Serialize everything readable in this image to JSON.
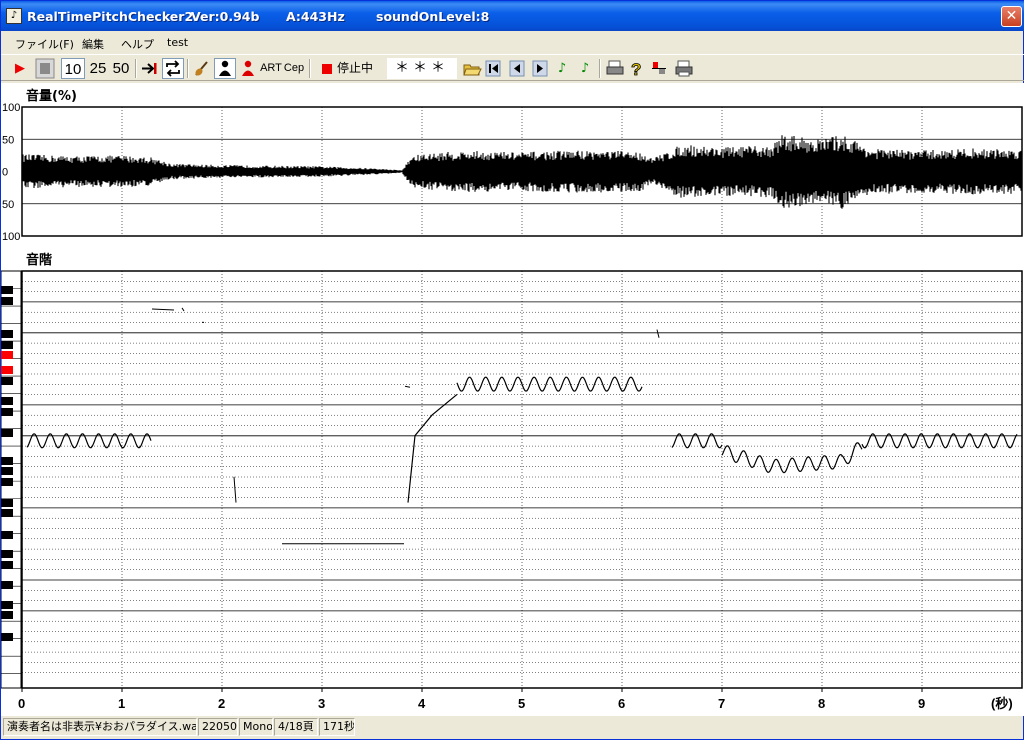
{
  "window": {
    "title_app": "RealTimePitchChecker2",
    "title_version": "Ver:0.94b",
    "title_pitch": "A:443Hz",
    "title_level": "soundOnLevel:8",
    "close_glyph": "✕"
  },
  "menu": [
    "ファイル(F)",
    "編集",
    "ヘルプ",
    "test"
  ],
  "toolbar": {
    "speed_10": "10",
    "speed_25": "25",
    "speed_50": "50",
    "art_label": "ART",
    "cep_label": "Cep",
    "status_label": "停止中",
    "note_display": "＊＊＊"
  },
  "volume_panel": {
    "title": "音量(%)",
    "ytick_labels": [
      "100",
      "50",
      "0",
      "50",
      "100"
    ]
  },
  "pitch_panel": {
    "title": "音階"
  },
  "time_axis": {
    "tick_labels": [
      "0",
      "1",
      "2",
      "3",
      "4",
      "5",
      "6",
      "7",
      "8",
      "9"
    ],
    "unit": "(秒)"
  },
  "statusbar": {
    "file": "演奏者名は非表示¥おおパラダイス.wav",
    "sample_rate": "22050",
    "channels": "Mono",
    "page": "4/18頁",
    "duration": "171秒"
  },
  "colors": {
    "titlebar": "#0a5fe8",
    "highlight_key": "#ff0000",
    "waveform": "#000000"
  },
  "chart_data": [
    {
      "type": "area",
      "title": "音量(%)",
      "xlim": [
        0,
        10
      ],
      "ylim": [
        -100,
        100
      ],
      "ytick_labels": [
        "100",
        "50",
        "0",
        "50",
        "100"
      ],
      "grid": true,
      "x": [
        0,
        0.5,
        1,
        1.3,
        1.5,
        2,
        2.5,
        3,
        3.5,
        3.8,
        3.9,
        4.2,
        4.5,
        5,
        5.5,
        6,
        6.2,
        6.3,
        6.6,
        7,
        7.5,
        7.6,
        8,
        8.2,
        8.5,
        9,
        9.5,
        10
      ],
      "amplitude": [
        27,
        24,
        25,
        22,
        12,
        10,
        9,
        8,
        5,
        2,
        25,
        30,
        32,
        30,
        33,
        32,
        30,
        20,
        42,
        38,
        40,
        58,
        50,
        58,
        35,
        33,
        36,
        34
      ]
    },
    {
      "type": "line",
      "title": "音階",
      "xlim": [
        0,
        10
      ],
      "xtick_labels": [
        "0",
        "1",
        "2",
        "3",
        "4",
        "5",
        "6",
        "7",
        "8",
        "9"
      ],
      "xlabel": "(秒)",
      "grid": true,
      "segments": [
        {
          "x": [
            0.05,
            1.3
          ],
          "pitch_row": 16,
          "vibrato": true
        },
        {
          "x": [
            3.86,
            3.93,
            4.1,
            4.35
          ],
          "pitch_row": [
            22,
            15.5,
            13.5,
            11.5
          ]
        },
        {
          "x": [
            4.35,
            6.2
          ],
          "pitch_row": 10.5,
          "vibrato": true
        },
        {
          "x": [
            6.5,
            7.0
          ],
          "pitch_row": 16,
          "vibrato": true
        },
        {
          "x": [
            7.0,
            7.5,
            8.2,
            8.4
          ],
          "pitch_row": [
            17,
            18.5,
            18,
            16.5
          ],
          "vibrato": true
        },
        {
          "x": [
            8.4,
            9.95
          ],
          "pitch_row": 16,
          "vibrato": true
        }
      ]
    }
  ]
}
